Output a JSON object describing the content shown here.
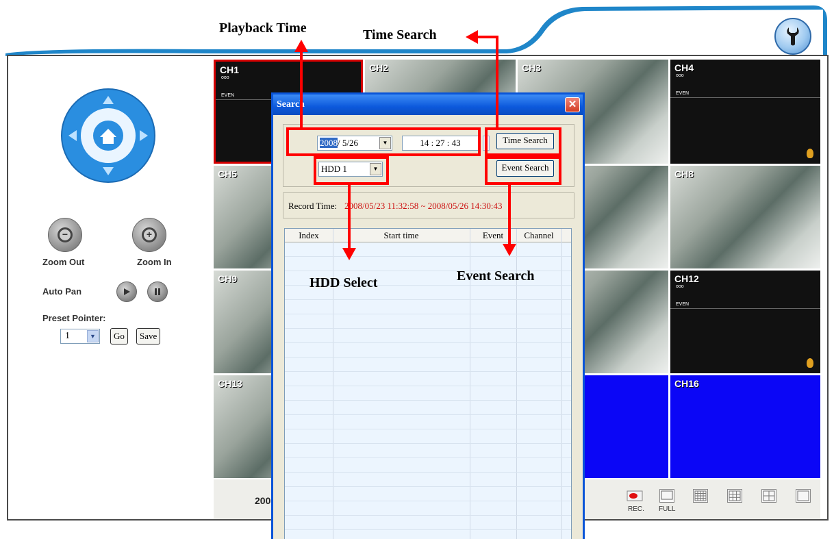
{
  "colors": {
    "header_blue": "#1f86c9",
    "ptz_blue": "#2a8ee0",
    "annotation_red": "#ff0000",
    "dialog_title_blue": "#0c59dc",
    "empty_channel_blue": "#0b06f6",
    "record_time_red": "#cc1111"
  },
  "header": {
    "settings_icon": "wrench-icon"
  },
  "left_panel": {
    "ptz_icons": [
      "up-arrow-icon",
      "down-arrow-icon",
      "left-arrow-icon",
      "right-arrow-icon",
      "home-icon"
    ],
    "zoom_out_label": "Zoom Out",
    "zoom_in_label": "Zoom In",
    "auto_pan_label": "Auto Pan",
    "preset_pointer_label": "Preset Pointer:",
    "preset_value": "1",
    "go_label": "Go",
    "save_label": "Save"
  },
  "channels": {
    "ch1": "CH1",
    "ch2": "CH2",
    "ch3": "CH3",
    "ch4": "CH4",
    "ch5": "CH5",
    "ch8": "CH8",
    "ch9": "CH9",
    "ch12": "CH12",
    "ch13": "CH13",
    "ch16": "CH16",
    "even_tag": "EVEN",
    "sub_tag": "ooo"
  },
  "toolbar": {
    "date_fragment": "200",
    "rec_label": "REC.",
    "full_label": "FULL"
  },
  "dialog": {
    "title": "Search",
    "date_year": "2008",
    "date_rest": "/ 5/26",
    "time_value": "14 : 27 : 43",
    "time_search_button": "Time Search",
    "hdd_value": "HDD 1",
    "event_search_button": "Event Search",
    "record_time_label": "Record Time:",
    "record_time_value": "2008/05/23 11:32:58 ~ 2008/05/26 14:30:43",
    "columns": [
      "Index",
      "Start time",
      "Event",
      "Channel"
    ]
  },
  "annotations": {
    "playback_time": "Playback Time",
    "time_search": "Time Search",
    "hdd_select": "HDD Select",
    "event_search": "Event Search"
  }
}
